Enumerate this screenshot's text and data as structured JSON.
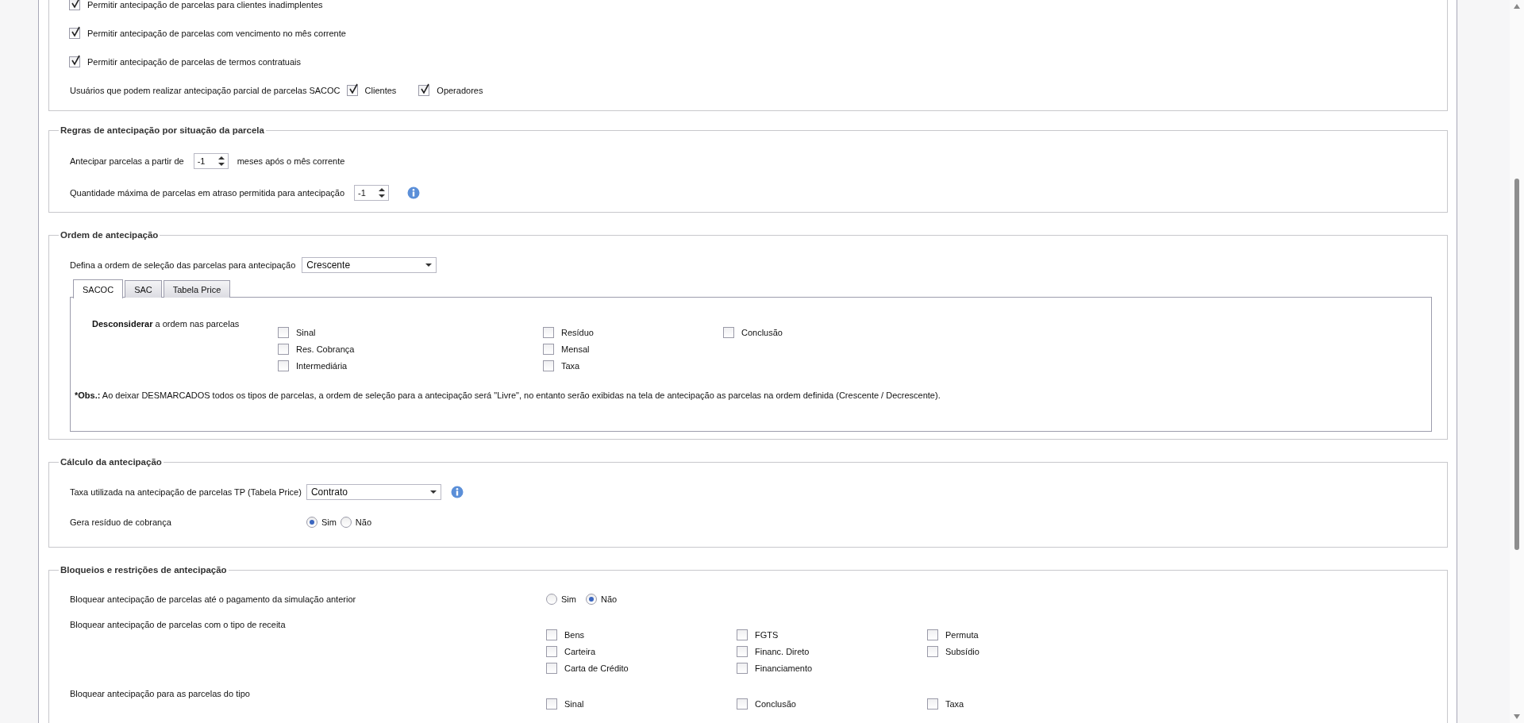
{
  "permissions": {
    "options": [
      {
        "label": "Permitir antecipação de parcelas para clientes inadimplentes",
        "checked": true
      },
      {
        "label": "Permitir antecipação de parcelas com vencimento no mês corrente",
        "checked": true
      },
      {
        "label": "Permitir antecipação de parcelas de termos contratuais",
        "checked": true
      }
    ],
    "partial_users": {
      "label": "Usuários que podem realizar antecipação parcial de parcelas SACOC",
      "options": [
        {
          "label": "Clientes",
          "checked": true
        },
        {
          "label": "Operadores",
          "checked": true
        }
      ]
    }
  },
  "situation_rules": {
    "title": "Regras de antecipação por situação da parcela",
    "rows": [
      {
        "label": "Antecipar parcelas a partir de",
        "value": "-1",
        "suffix": "meses após o mês corrente",
        "info": false
      },
      {
        "label": "Quantidade máxima de parcelas em atraso permitida para antecipação",
        "value": "-1",
        "info": true
      }
    ]
  },
  "order": {
    "title": "Ordem de antecipação",
    "select_label": "Defina a ordem de seleção das parcelas para antecipação",
    "select_value": "Crescente",
    "tabs": [
      {
        "label": "SACOC",
        "selected": true
      },
      {
        "label": "SAC",
        "selected": false
      },
      {
        "label": "Tabela Price",
        "selected": false
      }
    ],
    "ignore_label": "**Desconsiderar** a ordem nas parcelas",
    "columns": [
      [
        {
          "label": "Sinal",
          "checked": false
        },
        {
          "label": "Res. Cobrança",
          "checked": false
        },
        {
          "label": "Intermediária",
          "checked": false
        }
      ],
      [
        {
          "label": "Resíduo",
          "checked": false
        },
        {
          "label": "Mensal",
          "checked": false
        },
        {
          "label": "Taxa",
          "checked": false
        }
      ],
      [
        {
          "label": "Conclusão",
          "checked": false
        }
      ]
    ],
    "note_label": "*Obs.:",
    "note": "Ao deixar DESMARCADOS todos os tipos de parcelas, a ordem de seleção para a antecipação será \"Livre\", no entanto serão exibidas na tela de antecipação as parcelas na ordem definida (Crescente / Decrescente)."
  },
  "calculation": {
    "title": "Cálculo da antecipação",
    "rate_label": "Taxa utilizada na antecipação de parcelas TP (Tabela Price)",
    "rate_value": "Contrato",
    "rate_info": true,
    "residue_label": "Gera resíduo de cobrança",
    "residue_options": [
      {
        "label": "Sim",
        "selected": true
      },
      {
        "label": "Não",
        "selected": false
      }
    ]
  },
  "blocks": {
    "title": "Bloqueios e restrições de antecipação",
    "rows": [
      {
        "kind": "radio",
        "label": "Bloquear antecipação de parcelas até o pagamento da simulação anterior",
        "options": [
          {
            "label": "Sim",
            "selected": false
          },
          {
            "label": "Não",
            "selected": true
          }
        ]
      },
      {
        "kind": "checkgrid",
        "label": "Bloquear antecipação de parcelas com o tipo de receita",
        "columns": [
          [
            {
              "label": "Bens",
              "checked": false
            },
            {
              "label": "Carteira",
              "checked": false
            },
            {
              "label": "Carta de Crédito",
              "checked": false
            }
          ],
          [
            {
              "label": "FGTS",
              "checked": false
            },
            {
              "label": "Financ. Direto",
              "checked": false
            },
            {
              "label": "Financiamento",
              "checked": false
            }
          ],
          [
            {
              "label": "Permuta",
              "checked": false
            },
            {
              "label": "Subsídio",
              "checked": false
            }
          ]
        ]
      },
      {
        "kind": "checkgrid",
        "label": "Bloquear antecipação para as parcelas do tipo",
        "columns": [
          [
            {
              "label": "Sinal",
              "checked": false
            }
          ],
          [
            {
              "label": "Conclusão",
              "checked": false
            }
          ],
          [
            {
              "label": "Taxa",
              "checked": false
            }
          ]
        ]
      }
    ]
  }
}
